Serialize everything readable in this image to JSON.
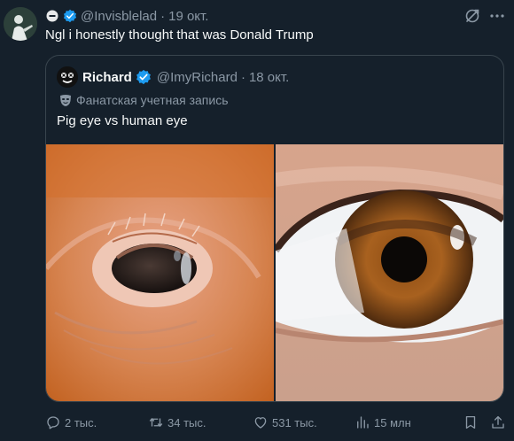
{
  "tweet": {
    "handle": "@Invisblelad",
    "date": "19 окт.",
    "text": "Ngl i honestly thought that was Donald Trump"
  },
  "quoted": {
    "name": "Richard",
    "handle": "@ImyRichard",
    "date": "18 окт.",
    "account_label": "Фанатская учетная запись",
    "text": "Pig eye vs human eye",
    "media": [
      {
        "icon": "pig-eye-photo"
      },
      {
        "icon": "human-eye-photo"
      }
    ]
  },
  "actions": {
    "replies": "2 тыс.",
    "retweets": "34 тыс.",
    "likes": "531 тыс.",
    "views": "15 млн"
  },
  "icons": {
    "header_badge": "circle-minus-icon",
    "verified": "verified-badge-icon",
    "grok": "grok-icon",
    "more": "more-icon",
    "reply": "reply-icon",
    "retweet": "retweet-icon",
    "like": "heart-icon",
    "views": "views-icon",
    "bookmark": "bookmark-icon",
    "share": "share-icon"
  },
  "colors": {
    "background": "#15202b",
    "text": "#f7f9f9",
    "muted": "#8b98a5",
    "verified": "#1d9bf0",
    "border": "#38444d"
  }
}
